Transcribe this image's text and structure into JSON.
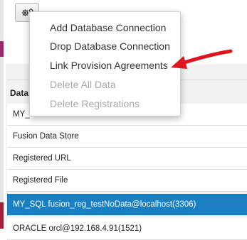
{
  "toolbar": {
    "gear_icon": "gear-icon"
  },
  "context_menu": {
    "items": [
      {
        "label": "Add Database Connection",
        "enabled": true
      },
      {
        "label": "Drop Database Connection",
        "enabled": true
      },
      {
        "label": "Link Provision Agreements",
        "enabled": true
      },
      {
        "label": "Delete All Data",
        "enabled": false
      },
      {
        "label": "Delete Registrations",
        "enabled": false
      }
    ]
  },
  "table": {
    "header": "Data",
    "rows": [
      {
        "label": "MY_",
        "selected": false
      },
      {
        "label": "Fusion Data Store",
        "selected": false
      },
      {
        "label": "Registered URL",
        "selected": false
      },
      {
        "label": "Registered File",
        "selected": false
      },
      {
        "label": "MY_SQL fusion_reg_testNoData@localhost(3306)",
        "selected": true
      },
      {
        "label": "ORACLE orcl@192.168.4.91(1521)",
        "selected": false
      }
    ]
  },
  "colors": {
    "selected_row": "#1a7fc1",
    "annotation_arrow": "#e0141e",
    "disabled_text": "#a9a9a9"
  }
}
